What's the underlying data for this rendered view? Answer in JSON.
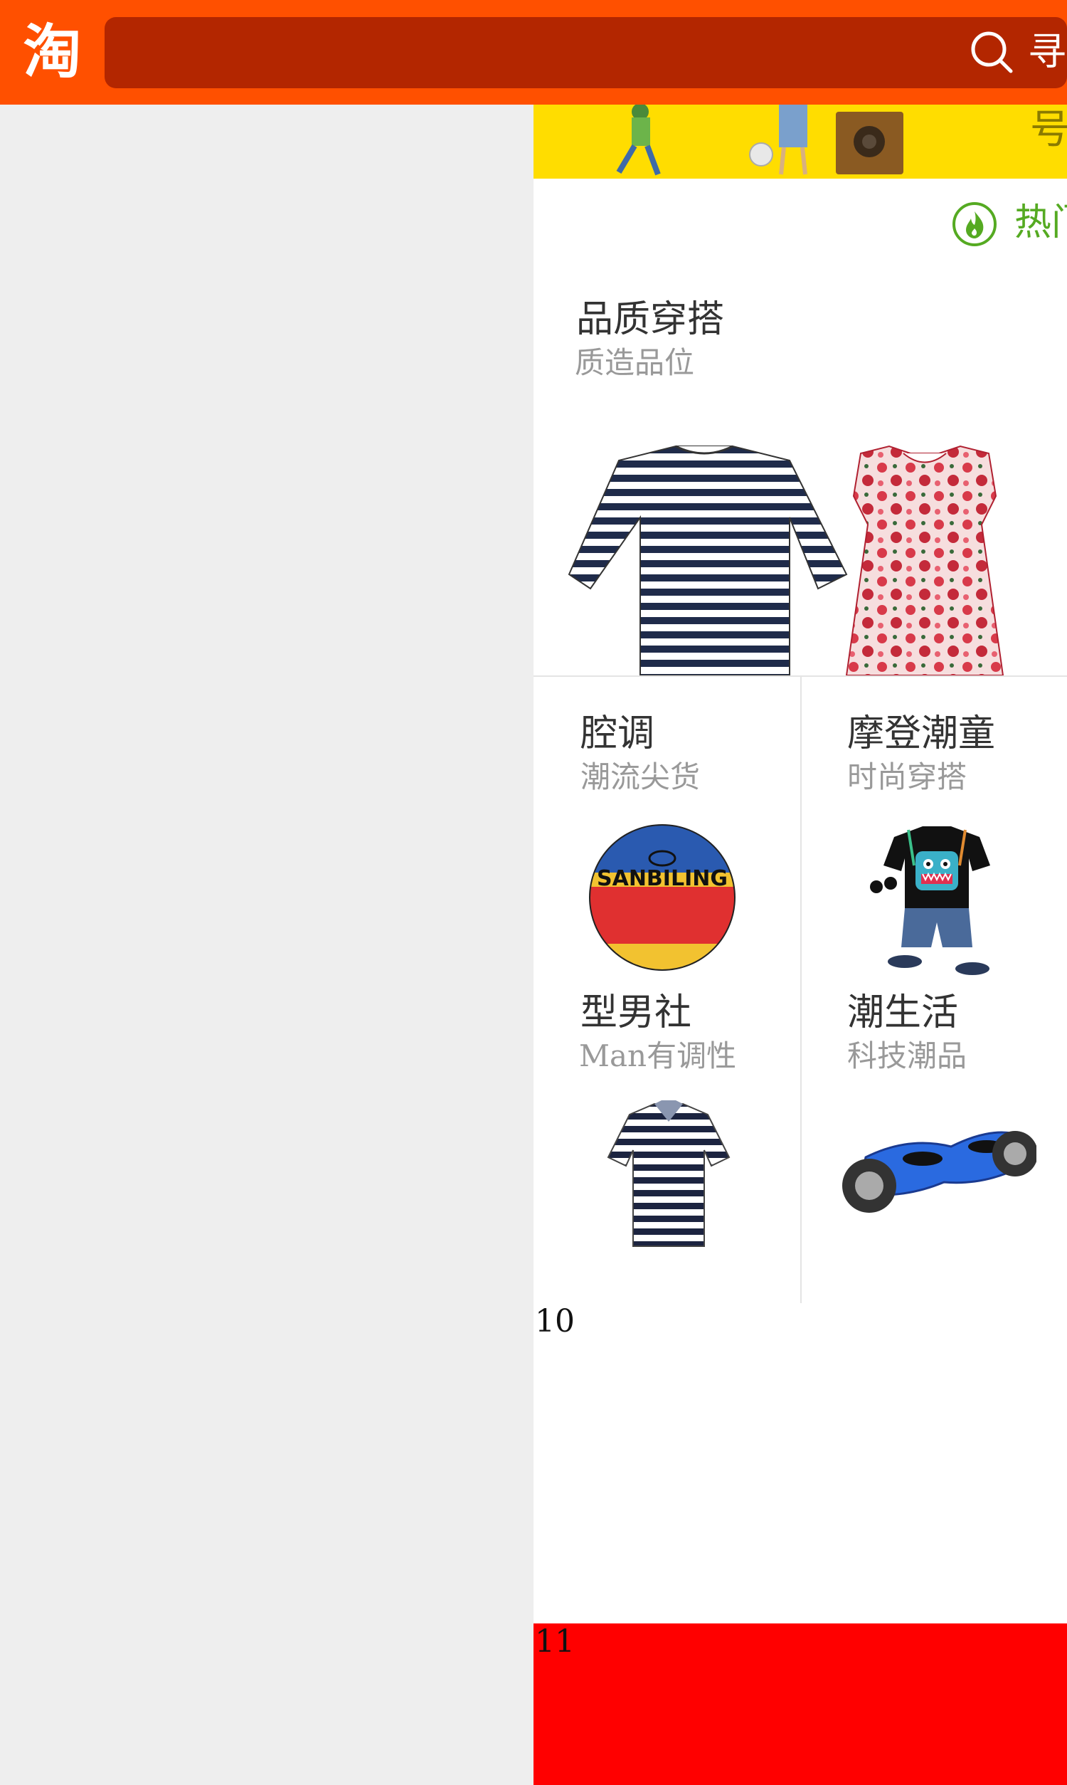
{
  "header": {
    "logo_text": "淘",
    "search_label": "寻",
    "colors": {
      "bar": "#ff5000",
      "search_bg": "#b32600"
    }
  },
  "panel": {
    "banner_char": "号",
    "hot_label": "热门",
    "featured": {
      "title": "品质穿搭",
      "subtitle": "质造品位"
    },
    "cells": [
      {
        "title": "腔调",
        "subtitle": "潮流尖货"
      },
      {
        "title": "摩登潮童",
        "subtitle": "时尚穿搭"
      },
      {
        "title": "型男社",
        "subtitle": "Man有调性"
      },
      {
        "title": "潮生活",
        "subtitle": "科技潮品"
      }
    ],
    "basketball_brand": "SANBILING",
    "marker_10": "10",
    "marker_11": "11",
    "colors": {
      "hot": "#55aa22",
      "red_block": "#ff0000",
      "banner": "#ffdd00"
    }
  }
}
